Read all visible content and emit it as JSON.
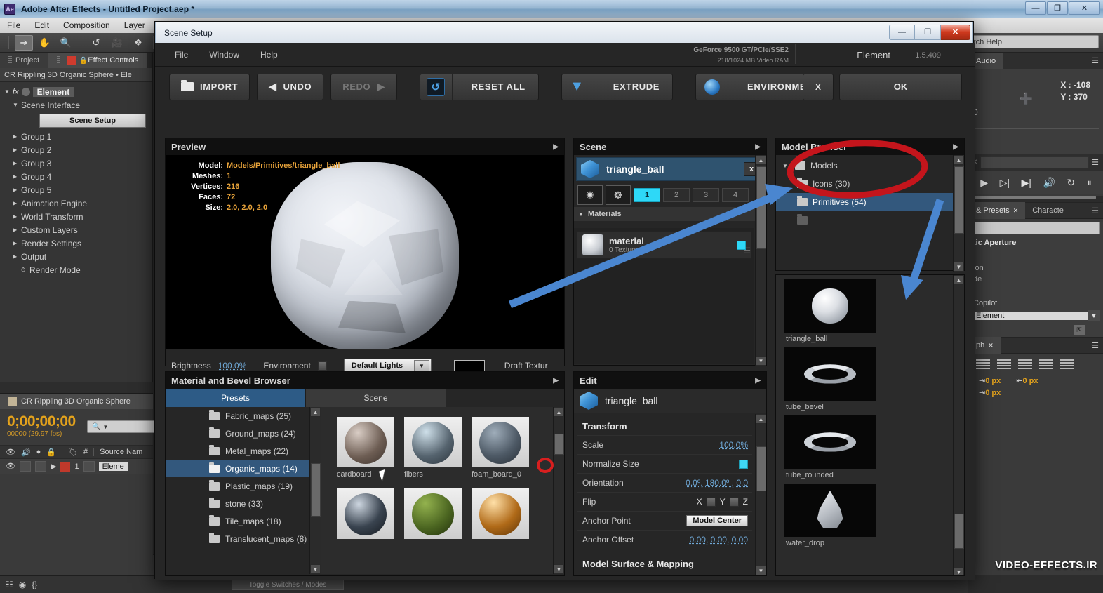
{
  "ae": {
    "title": "Adobe After Effects - Untitled Project.aep *",
    "logo": "Ae",
    "menu": [
      "File",
      "Edit",
      "Composition",
      "Layer"
    ],
    "search_help": "rch Help",
    "win_min": "—",
    "win_max": "❐",
    "win_close": "✕",
    "left_panel": {
      "tabs": [
        {
          "label": "Project"
        },
        {
          "label": "Effect Controls"
        }
      ],
      "header": "CR Rippling 3D Organic Sphere • Ele",
      "effect_name": "Element",
      "fx_label": "fx",
      "scene_interface": "Scene Interface",
      "scene_setup_button": "Scene Setup",
      "groups": [
        "Group 1",
        "Group 2",
        "Group 3",
        "Group 4",
        "Group 5",
        "Animation Engine",
        "World Transform",
        "Custom Layers",
        "Render Settings",
        "Output"
      ],
      "render_mode": "Render Mode"
    },
    "timeline": {
      "comp_name": "CR Rippling 3D Organic Sphere",
      "timecode": "0;00;00;00",
      "frames": "00000 (29.97 fps)",
      "search_placeholder": "",
      "col_source_name": "Source Nam",
      "layer_index": "1",
      "layer_name": "Eleme"
    },
    "right_panel": {
      "audio_tab": "Audio",
      "info_x": "X : -108",
      "info_y": "Y : 370",
      "info_zero": "0",
      "presets_tab": "& Presets",
      "character_tab": "Characte",
      "aperture_label": "tic Aperture",
      "frag1": "ion",
      "frag2": "de",
      "copilot": "Copilot",
      "element_field": "Element",
      "graph_tab": "ph",
      "indent_left": "0 px",
      "indent_right": "0 px",
      "indent_first": "0 px"
    },
    "bottom": {
      "toggle_switches": "Toggle Switches / Modes"
    },
    "watermark": "VIDEO-EFFECTS.IR"
  },
  "scene_setup": {
    "window_title": "Scene Setup",
    "win_min": "—",
    "win_max": "❐",
    "win_close": "✕",
    "menu": [
      "File",
      "Window",
      "Help"
    ],
    "gpu_line1": "GeForce 9500 GT/PCIe/SSE2",
    "gpu_line2": "218/1024 MB Video RAM",
    "product": "Element",
    "version": "1.5.409",
    "toolbar": {
      "import": "IMPORT",
      "undo": "UNDO",
      "redo": "REDO",
      "reset_all": "RESET ALL",
      "extrude": "EXTRUDE",
      "environment": "ENVIRONMENT",
      "cancel": "X",
      "ok": "OK"
    },
    "preview": {
      "title": "Preview",
      "info": [
        {
          "key": "Model:",
          "value": "Models/Primitives/triangle_ball"
        },
        {
          "key": "Meshes:",
          "value": "1"
        },
        {
          "key": "Vertices:",
          "value": "216"
        },
        {
          "key": "Faces:",
          "value": "72"
        },
        {
          "key": "Size:",
          "value": "2.0, 2.0, 2.0"
        }
      ],
      "brightness_label": "Brightness",
      "brightness_value": "100.0%",
      "environment_label": "Environment",
      "lights_dropdown": "Default Lights",
      "draft_texture": "Draft Textur"
    },
    "material_browser": {
      "title": "Material and Bevel Browser",
      "tabs": [
        {
          "label": "Presets",
          "active": true
        },
        {
          "label": "Scene",
          "active": false
        }
      ],
      "folders": [
        "Fabric_maps (25)",
        "Ground_maps (24)",
        "Metal_maps (22)",
        "Organic_maps (14)",
        "Plastic_maps (19)",
        "stone (33)",
        "Tile_maps (18)",
        "Translucent_maps (8)"
      ],
      "selected_folder": "Organic_maps (14)",
      "materials": [
        {
          "name": "cardboard",
          "color": "#6d5d53"
        },
        {
          "name": "fibers",
          "color": "#55636e"
        },
        {
          "name": "foam_board_0",
          "color": "#4e5a66"
        },
        {
          "name": "",
          "color": "#39434f"
        },
        {
          "name": "",
          "color": "#4a6420"
        },
        {
          "name": "",
          "color": "#b06a18"
        }
      ]
    },
    "scene": {
      "title": "Scene",
      "object_name": "triangle_ball",
      "close_label": "x",
      "view_buttons": [
        "1",
        "2",
        "3",
        "4"
      ],
      "active_view": "1",
      "materials_header": "Materials",
      "material": {
        "name": "material",
        "textures": "0 Textures"
      }
    },
    "edit": {
      "title": "Edit",
      "object_name": "triangle_ball",
      "section_transform": "Transform",
      "rows": [
        {
          "label": "Scale",
          "value": "100.0%",
          "type": "link"
        },
        {
          "label": "Normalize Size",
          "value": "",
          "type": "check-on"
        },
        {
          "label": "Orientation",
          "value": "0.0º, 180.0º , 0.0",
          "type": "link"
        },
        {
          "label": "Flip",
          "value": "X  Y  Z",
          "type": "flip"
        },
        {
          "label": "Anchor Point",
          "value": "Model Center",
          "type": "button"
        },
        {
          "label": "Anchor Offset",
          "value": "0.00, 0.00, 0.00",
          "type": "link"
        }
      ],
      "section_surface": "Model Surface & Mapping"
    },
    "model_browser": {
      "title": "Model Browser",
      "tree": [
        {
          "label": "Models",
          "depth": 0,
          "expanded": true,
          "selected": false
        },
        {
          "label": "Icons (30)",
          "depth": 1,
          "expanded": false,
          "selected": false
        },
        {
          "label": "Primitives (54)",
          "depth": 1,
          "expanded": false,
          "selected": true
        }
      ],
      "models": [
        {
          "name": "triangle_ball",
          "shape": "ball"
        },
        {
          "name": "tube_bevel",
          "shape": "ring"
        },
        {
          "name": "tube_rounded",
          "shape": "ring"
        },
        {
          "name": "water_drop",
          "shape": "drop"
        }
      ]
    }
  },
  "annotations": {
    "highlight_color": "#c4151c",
    "arrow_color": "#4a86d0"
  }
}
